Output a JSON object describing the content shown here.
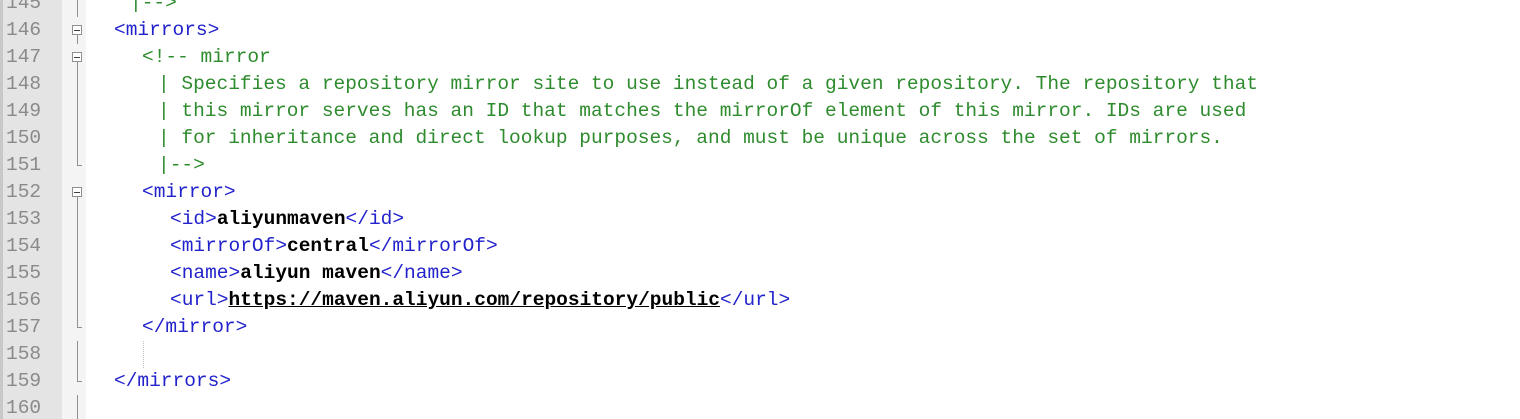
{
  "editor": {
    "lines": [
      {
        "num": "145",
        "fold": "line",
        "indent": 130,
        "parts": [
          {
            "cls": "comment",
            "text": "|-->"
          }
        ]
      },
      {
        "num": "146",
        "fold": "box",
        "indent": 114,
        "parts": [
          {
            "cls": "tag",
            "text": "<mirrors>"
          }
        ]
      },
      {
        "num": "147",
        "fold": "box",
        "indent": 142,
        "parts": [
          {
            "cls": "comment",
            "text": "<!-- mirror"
          }
        ]
      },
      {
        "num": "148",
        "fold": "line",
        "indent": 158,
        "parts": [
          {
            "cls": "comment",
            "text": "| Specifies a repository mirror site to use instead of a given repository. The repository that"
          }
        ]
      },
      {
        "num": "149",
        "fold": "line",
        "indent": 158,
        "parts": [
          {
            "cls": "comment",
            "text": "| this mirror serves has an ID that matches the mirrorOf element of this mirror. IDs are used"
          }
        ]
      },
      {
        "num": "150",
        "fold": "line",
        "indent": 158,
        "parts": [
          {
            "cls": "comment",
            "text": "| for inheritance and direct lookup purposes, and must be unique across the set of mirrors."
          }
        ]
      },
      {
        "num": "151",
        "fold": "end",
        "indent": 158,
        "parts": [
          {
            "cls": "comment",
            "text": "|-->"
          }
        ]
      },
      {
        "num": "152",
        "fold": "box",
        "indent": 142,
        "parts": [
          {
            "cls": "tag",
            "text": "<mirror>"
          }
        ]
      },
      {
        "num": "153",
        "fold": "line",
        "indent": 170,
        "parts": [
          {
            "cls": "tag",
            "text": "<id>"
          },
          {
            "cls": "bold",
            "text": "aliyunmaven"
          },
          {
            "cls": "tag",
            "text": "</id>"
          }
        ]
      },
      {
        "num": "154",
        "fold": "line",
        "indent": 170,
        "parts": [
          {
            "cls": "tag",
            "text": "<mirrorOf>"
          },
          {
            "cls": "bold",
            "text": "central"
          },
          {
            "cls": "tag",
            "text": "</mirrorOf>"
          }
        ]
      },
      {
        "num": "155",
        "fold": "line",
        "indent": 170,
        "parts": [
          {
            "cls": "tag",
            "text": "<name>"
          },
          {
            "cls": "bold",
            "text": "aliyun maven"
          },
          {
            "cls": "tag",
            "text": "</name>"
          }
        ]
      },
      {
        "num": "156",
        "fold": "line",
        "indent": 170,
        "parts": [
          {
            "cls": "tag",
            "text": "<url>"
          },
          {
            "cls": "link",
            "text": "https://maven.aliyun.com/repository/public"
          },
          {
            "cls": "tag",
            "text": "</url>"
          }
        ]
      },
      {
        "num": "157",
        "fold": "end",
        "indent": 142,
        "parts": [
          {
            "cls": "tag",
            "text": "</mirror>"
          }
        ]
      },
      {
        "num": "158",
        "fold": "line",
        "indent": 142,
        "parts": []
      },
      {
        "num": "159",
        "fold": "end",
        "indent": 114,
        "parts": [
          {
            "cls": "tag",
            "text": "</mirrors>"
          }
        ]
      },
      {
        "num": "160",
        "fold": "line",
        "indent": 114,
        "parts": []
      }
    ]
  }
}
